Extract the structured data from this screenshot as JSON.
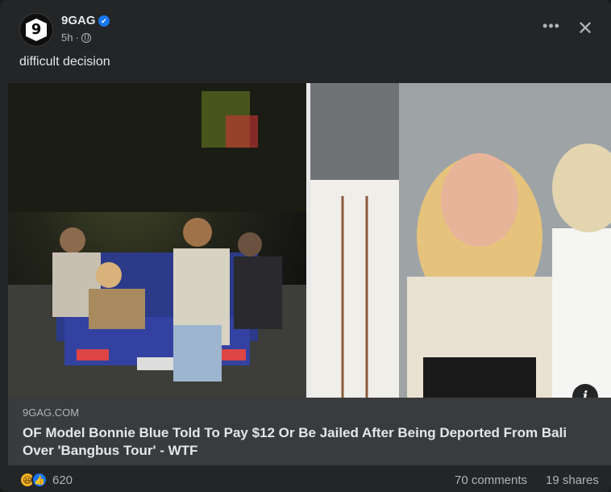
{
  "post": {
    "page_name": "9GAG",
    "avatar_text": "9",
    "time": "5h",
    "separator": "·",
    "caption": "difficult decision"
  },
  "icons": {
    "more": "more-options-icon",
    "close": "close-icon",
    "verified": "verified-badge-icon",
    "audience": "globe-icon",
    "info": "info-icon"
  },
  "link_preview": {
    "domain": "9GAG.COM",
    "title": "OF Model Bonnie Blue Told To Pay $12 Or Be Jailed After Being Deported From Bali Over 'Bangbus Tour' - WTF"
  },
  "stats": {
    "reaction_count": "620",
    "comments": "70 comments",
    "shares": "19 shares",
    "reaction_types": [
      "haha",
      "like"
    ]
  },
  "colors": {
    "card_bg": "#242526",
    "link_bg": "#3a3b3c",
    "verified": "#1877f2",
    "haha": "#f7b125",
    "like": "#1877f2"
  }
}
